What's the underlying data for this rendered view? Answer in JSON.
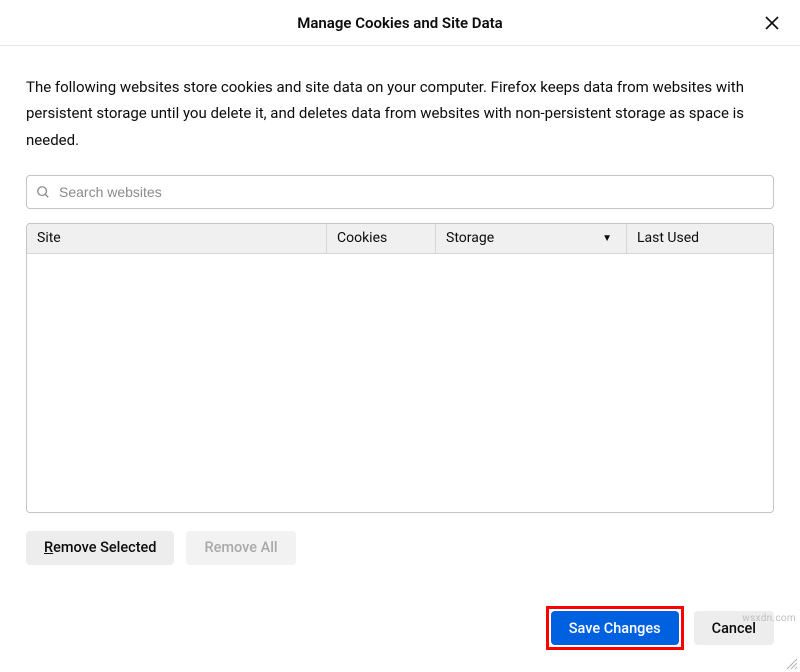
{
  "header": {
    "title": "Manage Cookies and Site Data"
  },
  "description": "The following websites store cookies and site data on your computer. Firefox keeps data from websites with persistent storage until you delete it, and deletes data from websites with non-persistent storage as space is needed.",
  "search": {
    "placeholder": "Search websites"
  },
  "table": {
    "headers": {
      "site": "Site",
      "cookies": "Cookies",
      "storage": "Storage",
      "lastused": "Last Used"
    },
    "sort_indicator": "▼"
  },
  "buttons": {
    "remove_selected": "Remove Selected",
    "remove_all": "Remove All",
    "save_changes": "Save Changes",
    "cancel": "Cancel"
  },
  "watermark": "wsxdn.com"
}
